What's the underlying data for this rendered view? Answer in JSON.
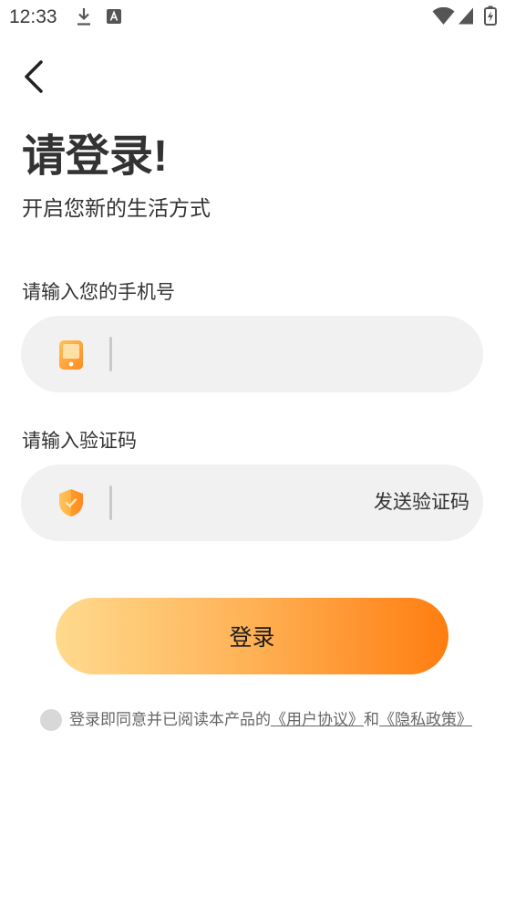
{
  "status_bar": {
    "time": "12:33",
    "left_icons": [
      "download-icon",
      "font-a-icon"
    ],
    "right_icons": [
      "wifi-icon",
      "signal-icon",
      "battery-charging-icon"
    ]
  },
  "header": {
    "back_icon": "chevron-left-icon"
  },
  "title": "请登录!",
  "subtitle": "开启您新的生活方式",
  "phone": {
    "label": "请输入您的手机号",
    "value": "",
    "icon": "phone-icon"
  },
  "code": {
    "label": "请输入验证码",
    "value": "",
    "icon": "shield-check-icon",
    "send_label": "发送验证码"
  },
  "login_button": {
    "label": "登录",
    "gradient_start": "#ffda8e",
    "gradient_mid": "#ffb155",
    "gradient_end": "#ff7d10"
  },
  "agreement": {
    "checked": false,
    "prefix": "登录即同意并已阅读本产品的",
    "user_agreement": "《用户协议》",
    "and": "和",
    "privacy_policy": "《隐私政策》"
  },
  "colors": {
    "accent": "#ff8a1f",
    "input_background": "#f1f1f1",
    "text": "#333333",
    "muted_text": "#666666",
    "checkbox_unchecked": "#d8d8d8"
  }
}
